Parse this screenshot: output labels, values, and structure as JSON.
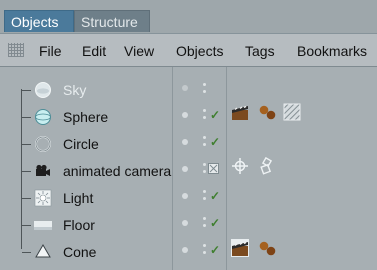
{
  "tabs": {
    "objects": "Objects",
    "structure": "Structure"
  },
  "menu": [
    "File",
    "Edit",
    "View",
    "Objects",
    "Tags",
    "Bookmarks"
  ],
  "objects": [
    {
      "name": "Sky",
      "icon": "sky-icon",
      "dim": true
    },
    {
      "name": "Sphere",
      "icon": "sphere-icon",
      "tags": [
        "clapboard-tag-icon",
        "material-balls-tag-icon",
        "hatched-texture-tag-icon"
      ]
    },
    {
      "name": "Circle",
      "icon": "circle-spline-icon"
    },
    {
      "name": "animated camera",
      "icon": "camera-icon",
      "tags": [
        "target-tag-icon",
        "protection-tag-icon"
      ]
    },
    {
      "name": "Light",
      "icon": "light-icon"
    },
    {
      "name": "Floor",
      "icon": "floor-icon"
    },
    {
      "name": "Cone",
      "icon": "cone-icon",
      "tags": [
        "clapboard-tag-icon",
        "material-balls-tag-icon"
      ]
    }
  ],
  "colors": {
    "active_tab": "#4b7a9b",
    "check_green": "#3f7f2f",
    "menu_bar": "#b6bcc0"
  }
}
